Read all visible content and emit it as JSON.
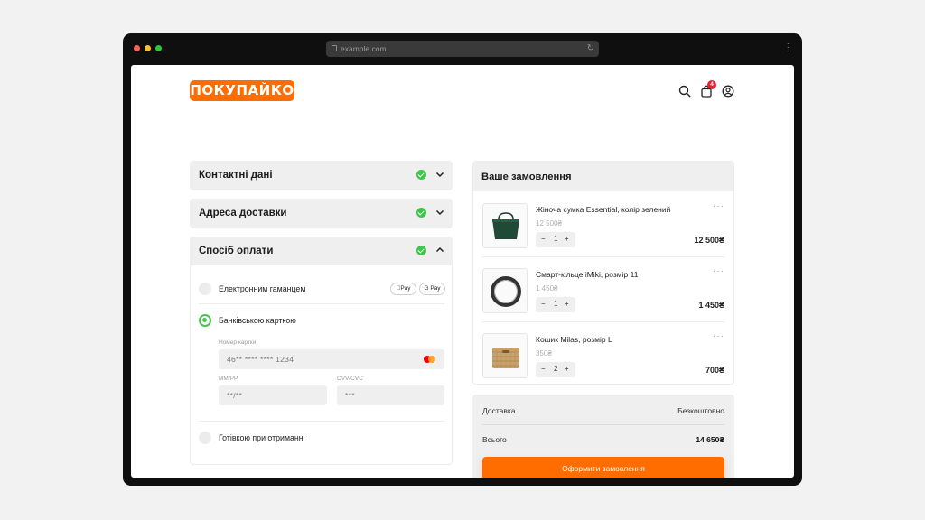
{
  "browser": {
    "url": "example.com"
  },
  "header": {
    "logo_text": "ПОКУПАЙКО",
    "cart_count": "4",
    "accent": "#ff6d00"
  },
  "checkout": {
    "sections": [
      {
        "title": "Контактні дані",
        "completed": true,
        "expanded": false
      },
      {
        "title": "Адреса доставки",
        "completed": true,
        "expanded": false
      },
      {
        "title": "Спосіб оплати",
        "completed": true,
        "expanded": true
      }
    ],
    "payment": {
      "wallet_label": "Електронним гаманцем",
      "apple_pay": "Pay",
      "google_pay": "G Pay",
      "card_label": "Банківською карткою",
      "card_number_label": "Номер картки",
      "card_number_value": "46** **** **** 1234",
      "expiry_label": "MM/РР",
      "expiry_value": "**/**",
      "cvv_label": "CVV/CVC",
      "cvv_value": "***",
      "cash_label": "Готівкою при отриманні",
      "selected": "card"
    }
  },
  "order": {
    "title": "Ваше замовлення",
    "items": [
      {
        "name": "Жіноча сумка Essential, колір зелений",
        "price": "12 500₴",
        "qty": "1",
        "total": "12 500₴"
      },
      {
        "name": "Смарт-кільце iMiki, розмір 11",
        "price": "1 450₴",
        "qty": "1",
        "total": "1 450₴"
      },
      {
        "name": "Кошик Milas, розмір L",
        "price": "350₴",
        "qty": "2",
        "total": "700₴"
      }
    ],
    "delivery_label": "Доставка",
    "delivery_value": "Безкоштовно",
    "total_label": "Всього",
    "total_value": "14 650₴",
    "submit_label": "Оформити замовлення"
  }
}
